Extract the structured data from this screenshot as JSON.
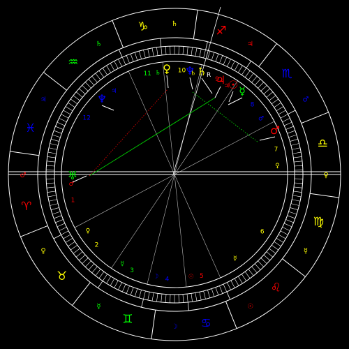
{
  "colors": {
    "background": "#000000",
    "wheel": "#ffffff",
    "fire": "#ff0000",
    "earth": "#ffff00",
    "air": "#00ff00",
    "water": "#0000ff",
    "trine": "#00c000",
    "square": "#c00000",
    "sextile": "#00c000"
  },
  "signs": [
    {
      "name": "aries",
      "glyph": "♈",
      "color": "#ff0000"
    },
    {
      "name": "taurus",
      "glyph": "♉",
      "color": "#ffff00"
    },
    {
      "name": "gemini",
      "glyph": "♊",
      "color": "#00ff00"
    },
    {
      "name": "cancer",
      "glyph": "♋",
      "color": "#0000ff"
    },
    {
      "name": "leo",
      "glyph": "♌",
      "color": "#ff0000"
    },
    {
      "name": "virgo",
      "glyph": "♍",
      "color": "#ffff00"
    },
    {
      "name": "libra",
      "glyph": "♎",
      "color": "#ffff00"
    },
    {
      "name": "scorpio",
      "glyph": "♏",
      "color": "#0000ff"
    },
    {
      "name": "sagittarius",
      "glyph": "♐",
      "color": "#ff0000"
    },
    {
      "name": "capricorn",
      "glyph": "♑",
      "color": "#ffff00"
    },
    {
      "name": "aquarius",
      "glyph": "♒",
      "color": "#00ff00"
    },
    {
      "name": "pisces",
      "glyph": "♓",
      "color": "#0000ff"
    }
  ],
  "sign_rulers": [
    {
      "glyph": "♂",
      "color": "#ff0000"
    },
    {
      "glyph": "♀",
      "color": "#ffff00"
    },
    {
      "glyph": "☿",
      "color": "#00ff00"
    },
    {
      "glyph": "☽",
      "color": "#0000ff"
    },
    {
      "glyph": "☉",
      "color": "#ff0000"
    },
    {
      "glyph": "☿",
      "color": "#ffff00"
    },
    {
      "glyph": "♀",
      "color": "#ffff00"
    },
    {
      "glyph": "♂",
      "color": "#0000ff"
    },
    {
      "glyph": "♃",
      "color": "#ff0000"
    },
    {
      "glyph": "♄",
      "color": "#ffff00"
    },
    {
      "glyph": "♄",
      "color": "#00ff00"
    },
    {
      "glyph": "♃",
      "color": "#0000ff"
    }
  ],
  "houses": [
    {
      "number": "1",
      "ruler": "♂",
      "color": "#ff0000"
    },
    {
      "number": "2",
      "ruler": "♀",
      "color": "#ffff00"
    },
    {
      "number": "3",
      "ruler": "☿",
      "color": "#00ff00"
    },
    {
      "number": "4",
      "ruler": "☽",
      "color": "#0000ff"
    },
    {
      "number": "5",
      "ruler": "☉",
      "color": "#ff0000"
    },
    {
      "number": "6",
      "ruler": "☿",
      "color": "#ffff00"
    },
    {
      "number": "7",
      "ruler": "♀",
      "color": "#ffff00"
    },
    {
      "number": "8",
      "ruler": "♂",
      "color": "#0000ff"
    },
    {
      "number": "9",
      "ruler": "♃",
      "color": "#ff0000"
    },
    {
      "number": "10",
      "ruler": "♄",
      "color": "#ffff00"
    },
    {
      "number": "11",
      "ruler": "♄",
      "color": "#00ff00"
    },
    {
      "number": "12",
      "ruler": "♃",
      "color": "#0000ff"
    }
  ],
  "planets": [
    {
      "name": "uranus",
      "glyph": "♅",
      "color": "#00ff00"
    },
    {
      "name": "neptune",
      "glyph": "♆",
      "color": "#0000ff"
    },
    {
      "name": "venus",
      "glyph": "♀",
      "color": "#ffff00"
    },
    {
      "name": "neptune-2",
      "glyph": "♆",
      "color": "#0000ff"
    },
    {
      "name": "saturn",
      "glyph": "♄",
      "color": "#ffff00"
    },
    {
      "name": "jupiter",
      "glyph": "♃",
      "color": "#ff0000"
    },
    {
      "name": "sun",
      "glyph": "☉",
      "color": "#ff0000"
    },
    {
      "name": "mercury",
      "glyph": "☿",
      "color": "#00ff00"
    },
    {
      "name": "mars",
      "glyph": "♂",
      "color": "#ff0000"
    }
  ],
  "planet_labels": {
    "saturn_retrograde": "R"
  },
  "aspects": [
    {
      "kind": "trine",
      "color": "#00c000",
      "style": "solid"
    },
    {
      "kind": "square",
      "color": "#c00000",
      "style": "dotted"
    },
    {
      "kind": "sextile",
      "color": "#00c000",
      "style": "dotted"
    }
  ]
}
